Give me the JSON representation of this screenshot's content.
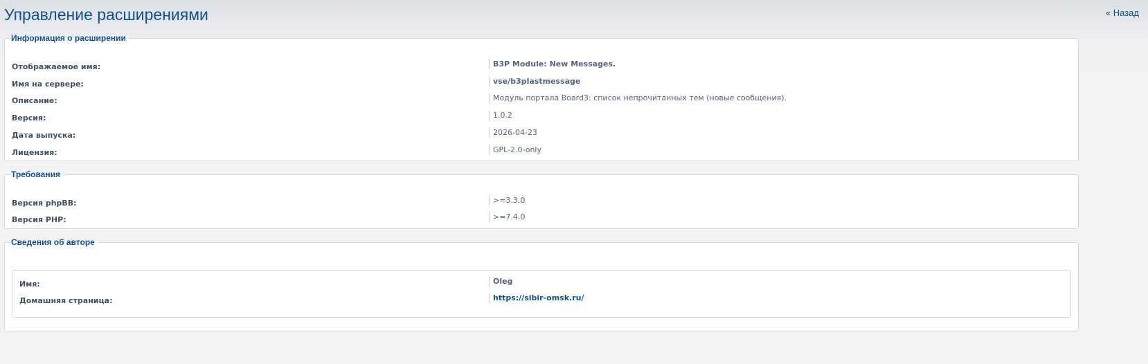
{
  "header": {
    "title": "Управление расширениями",
    "back_label": "« Назад"
  },
  "info": {
    "legend": "Информация о расширении",
    "rows": [
      {
        "label": "Отображаемое имя:",
        "value": "B3P Module: New Messages."
      },
      {
        "label": "Имя на сервере:",
        "value": "vse/b3plastmessage"
      },
      {
        "label": "Описание:",
        "value": "Модуль портала Board3: список непрочитанных тем (новые сообщения)."
      },
      {
        "label": "Версия:",
        "value": "1.0.2"
      },
      {
        "label": "Дата выпуска:",
        "value": "2026-04-23"
      },
      {
        "label": "Лицензия:",
        "value": "GPL-2.0-only"
      }
    ]
  },
  "requirements": {
    "legend": "Требования",
    "rows": [
      {
        "label": "Версия phpBB:",
        "value": ">=3.3.0"
      },
      {
        "label": "Версия PHP:",
        "value": ">=7.4.0"
      }
    ]
  },
  "author": {
    "legend": "Сведения об авторе",
    "rows": [
      {
        "label": "Имя:",
        "value": "Oleg"
      },
      {
        "label": "Домашняя страница:",
        "value": "https://sibir-omsk.ru/"
      }
    ]
  }
}
